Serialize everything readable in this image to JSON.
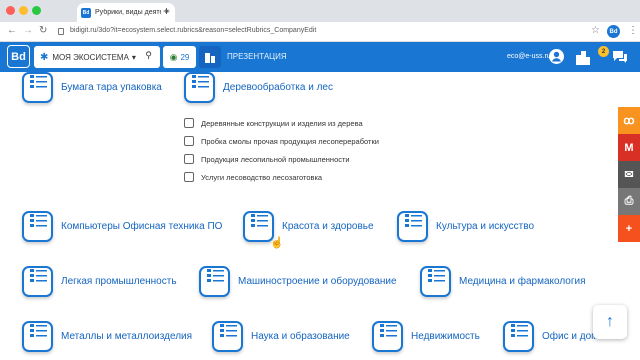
{
  "browser": {
    "tab_title": "Рубрики, виды деятельности",
    "tab_close": "×",
    "new_tab": "+",
    "back": "←",
    "forward": "→",
    "reload": "↻",
    "url": "bidigit.ru/3do?it=ecosystem.select.rubrics&reason=selectRubrics_CompanyEdit",
    "bookmark": "☆",
    "profile_label": "Bd",
    "menu": "⋮",
    "favicon_label": "Bd"
  },
  "nav": {
    "logo": "Bd",
    "ecosystem_label": "МОЯ ЭКОСИСТЕМА",
    "ecosystem_arrow": "▾",
    "views_count": "29",
    "presentation_label": "ПРЕЗЕНТАЦИЯ",
    "email": "eco@e-uss.ru",
    "notifications_badge": "2"
  },
  "categories": [
    {
      "label": "Бумага тара упаковка"
    },
    {
      "label": "Деревообработка и лес"
    },
    {
      "label": "Компьютеры Офисная техника ПО"
    },
    {
      "label": "Красота и здоровье"
    },
    {
      "label": "Культура и искусство"
    },
    {
      "label": "Легкая промышленность"
    },
    {
      "label": "Машиностроение и оборудование"
    },
    {
      "label": "Медицина и фармакология"
    },
    {
      "label": "Металлы и металлоизделия"
    },
    {
      "label": "Наука и образование"
    },
    {
      "label": "Недвижимость"
    },
    {
      "label": "Офис и дом"
    }
  ],
  "subcategories": [
    {
      "label": "Деревянные конструкции и изделия из дерева",
      "checked": false
    },
    {
      "label": "Пробка смолы прочая продукция лесопереработки",
      "checked": false
    },
    {
      "label": "Продукция лесопильной промышленности",
      "checked": false
    },
    {
      "label": "Услуги лесоводство лесозаготовка",
      "checked": false
    }
  ],
  "side_share": [
    {
      "name": "ok",
      "glyph": "ꝏ",
      "color": "#f7931e"
    },
    {
      "name": "gmail",
      "glyph": "M",
      "color": "#d93025"
    },
    {
      "name": "mail",
      "glyph": "✉",
      "color": "#555555"
    },
    {
      "name": "print",
      "glyph": "⎙",
      "color": "#777777"
    },
    {
      "name": "more",
      "glyph": "+",
      "color": "#f4511e"
    }
  ],
  "scroll_top": "↑",
  "colors": {
    "brand": "#1976d2",
    "accent": "#1565c0"
  }
}
